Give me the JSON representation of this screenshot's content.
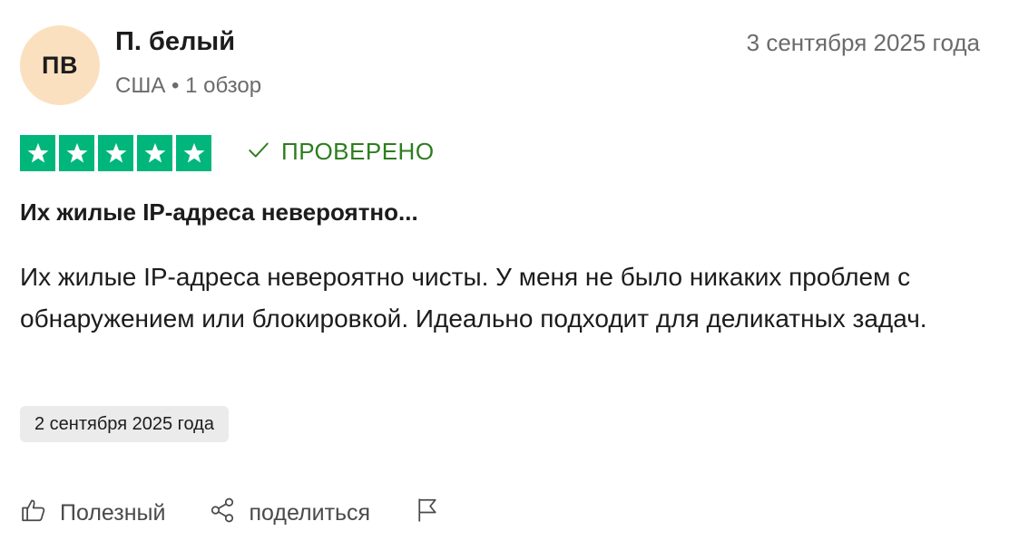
{
  "author": {
    "initials": "ПВ",
    "name": "П. белый",
    "meta": "США • 1 обзор"
  },
  "review_date": "3 сентября 2025 года",
  "rating": {
    "stars": 5,
    "max": 5,
    "color": "#00b67a"
  },
  "verified": {
    "label": "ПРОВЕРЕНО",
    "icon": "check-icon",
    "color": "#2e7d1f"
  },
  "review": {
    "title": "Их жилые IP-адреса невероятно...",
    "body": "Их жилые IP-адреса невероятно чисты. У меня не было никаких проблем с обнаружением или блокировкой. Идеально подходит для деликатных задач."
  },
  "experience_date": "2 сентября 2025 года",
  "actions": {
    "helpful": {
      "label": "Полезный",
      "icon": "thumbs-up-icon"
    },
    "share": {
      "label": "поделиться",
      "icon": "share-icon"
    },
    "report": {
      "icon": "flag-icon"
    }
  },
  "colors": {
    "avatar_bg": "#fbe0c0",
    "chip_bg": "#ebebeb"
  }
}
